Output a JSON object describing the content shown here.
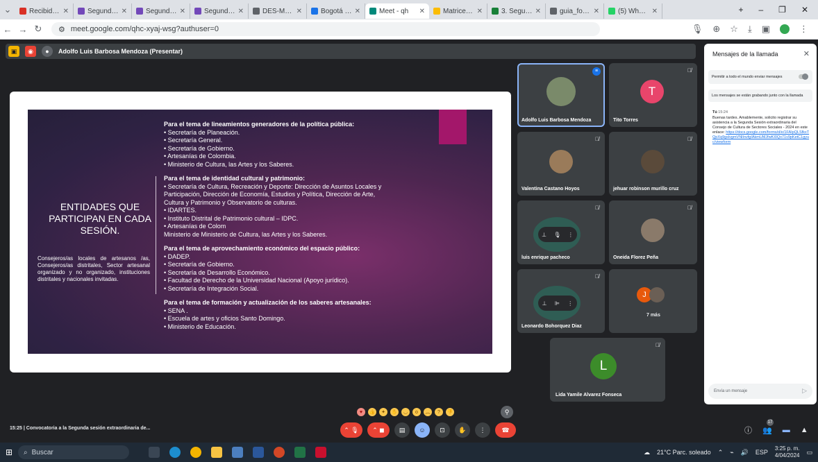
{
  "browser": {
    "tabs": [
      {
        "label": "Recibidos (56)",
        "color": "#d93025",
        "active": false
      },
      {
        "label": "Segunda Sesi",
        "color": "#7248b9",
        "active": false
      },
      {
        "label": "Segunda Sesi",
        "color": "#7248b9",
        "active": false
      },
      {
        "label": "Segunda Sesi",
        "color": "#7248b9",
        "active": false
      },
      {
        "label": "DES-MN-01-FI",
        "color": "#5f6368",
        "active": false
      },
      {
        "label": "Bogotá es TIC",
        "color": "#1a73e8",
        "active": false
      },
      {
        "label": "Meet - qh",
        "color": "#00897b",
        "active": true
      },
      {
        "label": "Matrices de s",
        "color": "#fbbc04",
        "active": false
      },
      {
        "label": "3. Seguimiento",
        "color": "#188038",
        "active": false
      },
      {
        "label": "guia_formulac",
        "color": "#5f6368",
        "active": false
      },
      {
        "label": "(5) WhatsApp",
        "color": "#25d366",
        "active": false
      }
    ],
    "url": "meet.google.com/qhc-xyaj-wsg?authuser=0"
  },
  "presenter": {
    "label": "Adolfo Luis Barbosa Mendoza (Presentar)"
  },
  "slide": {
    "left_title": "ENTIDADES QUE PARTICIPAN EN CADA SESIÓN.",
    "left_body": "Consejeros/as locales de artesanos /as, Consejeros/as distritales, Sector artesanal organizado y no organizado, instituciones distritales y nacionales invitadas.",
    "sections": [
      {
        "heading": "Para el tema de lineamientos generadores de la política pública:",
        "items": [
          "•      Secretaría de Planeación.",
          "•      Secretaría General.",
          "•      Secretaría de Gobierno.",
          "•      Artesanías de Colombia.",
          "•      Ministerio de Cultura, las Artes y los Saberes."
        ]
      },
      {
        "heading": "Para el tema de identidad cultural y patrimonio:",
        "items": [
          "• Secretaría de Cultura, Recreación y Deporte: Dirección de Asuntos Locales y",
          "Participación, Dirección de Economía, Estudios y Política,  Dirección de Arte,",
          "Cultura y Patrimonio y Observatorio de culturas.",
          "• IDARTES.",
          "• Instituto Distrital de Patrimonio cultural – IDPC.",
          "• Artesanías de Colom",
          "Ministerio de  Ministerio de Cultura, las Artes y los Saberes."
        ]
      },
      {
        "heading": "Para el tema de aprovechamiento económico del espacio público:",
        "items": [
          "• DADEP.",
          "• Secretaría de Gobierno.",
          "• Secretaría de Desarrollo Económico.",
          "• Facultad de Derecho de la Universidad Nacional (Apoyo jurídico).",
          "• Secretaría de Integración Social."
        ]
      },
      {
        "heading": "Para el tema de formación y actualización de los saberes artesanales:",
        "items": [
          "• SENA .",
          "• Escuela de artes y oficios Santo Domingo.",
          "• Ministerio de Educación."
        ]
      }
    ]
  },
  "participants": [
    {
      "name": "Adolfo Luis Barbosa Mendoza",
      "type": "photo",
      "color": "#7a8a6a"
    },
    {
      "name": "Tito Torres",
      "type": "letter",
      "letter": "T",
      "color": "#e8456b"
    },
    {
      "name": "Valentina Castano Hoyos",
      "type": "photo",
      "color": "#9a7b5a"
    },
    {
      "name": "jehuar robinson murillo cruz",
      "type": "photo",
      "color": "#5a4a3a"
    },
    {
      "name": "luis enrique pacheco",
      "type": "pinned"
    },
    {
      "name": "Oneida Florez Peña",
      "type": "photo",
      "color": "#8a7a6a"
    },
    {
      "name": "Leonardo Bohorquez Diaz",
      "type": "pinned"
    },
    {
      "name": "7 más",
      "type": "more",
      "letter": "J",
      "color": "#e8590c"
    },
    {
      "name": "Lida Yamile Alvarez Fonseca",
      "type": "letter",
      "letter": "L",
      "color": "#3c8c2a"
    }
  ],
  "chat": {
    "title": "Mensajes de la llamada",
    "permission": "Permitir a todo el mundo enviar mensajes",
    "recording_notice": "Los mensajes se están grabando junto con la llamada",
    "sender": "Tú",
    "time": "15:24",
    "message": "Buenas tardes. Amablemente, solicito registrar su asistencia a la Segunda Sesión extraordinaria del Consejo de Cultura de Sectores Sociales - 2024 en este enlace:",
    "link": "https://docs.google.com/forms/d/e/1FAIpQLSfkxTQpXq9gslvgmVNlInvfgIAkmUMJfwKI0Qx71v9pKetC1gyuc/viewform",
    "input_placeholder": "Envía un mensaje"
  },
  "meeting": {
    "time": "15:25",
    "separator": "|",
    "title": "Convocatoria a la Segunda sesión extraordinaria de..."
  },
  "participants_count": "17",
  "taskbar": {
    "search_placeholder": "Buscar",
    "weather": "21°C  Parc. soleado",
    "language": "ESP",
    "clock_time": "3:25 p. m.",
    "clock_date": "4/04/2024"
  }
}
